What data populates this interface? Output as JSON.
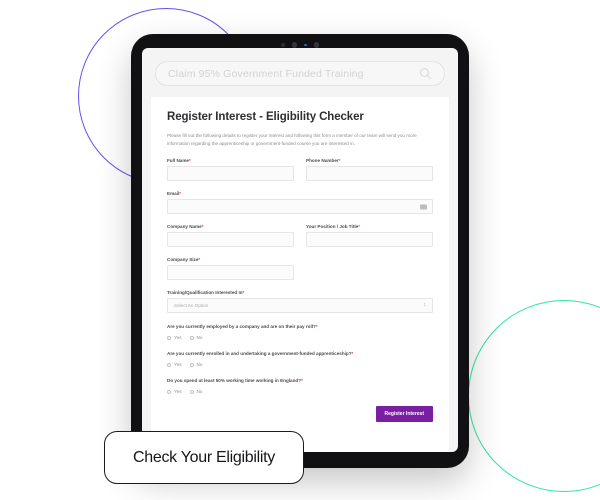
{
  "decor": {
    "purple_circle_color": "#6c4df0",
    "green_circle_color": "#2ee6a0"
  },
  "search": {
    "placeholder": "Claim 95% Government Funded Training",
    "icon": "search-icon"
  },
  "form": {
    "title": "Register Interest - Eligibility Checker",
    "intro": "Please fill out the following details to register your interest and following this form a member of our team will send you more information regarding the apprenticeship or government-funded course you are interested in.",
    "required_marker": "*",
    "fields": [
      {
        "label": "Full Name",
        "required": true,
        "value": ""
      },
      {
        "label": "Phone Number",
        "required": true,
        "value": ""
      },
      {
        "label": "Email",
        "required": true,
        "value": "",
        "icon": "envelope-icon"
      },
      {
        "label": "Company Name",
        "required": true,
        "value": ""
      },
      {
        "label": "Your Position / Job Title",
        "required": true,
        "value": ""
      },
      {
        "label": "Company Size",
        "required": true,
        "value": ""
      }
    ],
    "select": {
      "label": "Training/Qualification Interested In",
      "required": true,
      "value": "Select An Option"
    },
    "questions": [
      {
        "text": "Are you currently employed by a company and are on their pay roll?",
        "required": true,
        "options": [
          "Yes",
          "No"
        ]
      },
      {
        "text": "Are you currently enrolled in and undertaking a government-funded apprenticeship?",
        "required": true,
        "options": [
          "Yes",
          "No"
        ]
      },
      {
        "text": "Do you spend at least 50% working time working in England?",
        "required": true,
        "options": [
          "Yes",
          "No"
        ]
      }
    ],
    "submit_label": "Register Interest",
    "submit_color": "#7a1fa2"
  },
  "callout": {
    "label": "Check Your Eligibility"
  }
}
